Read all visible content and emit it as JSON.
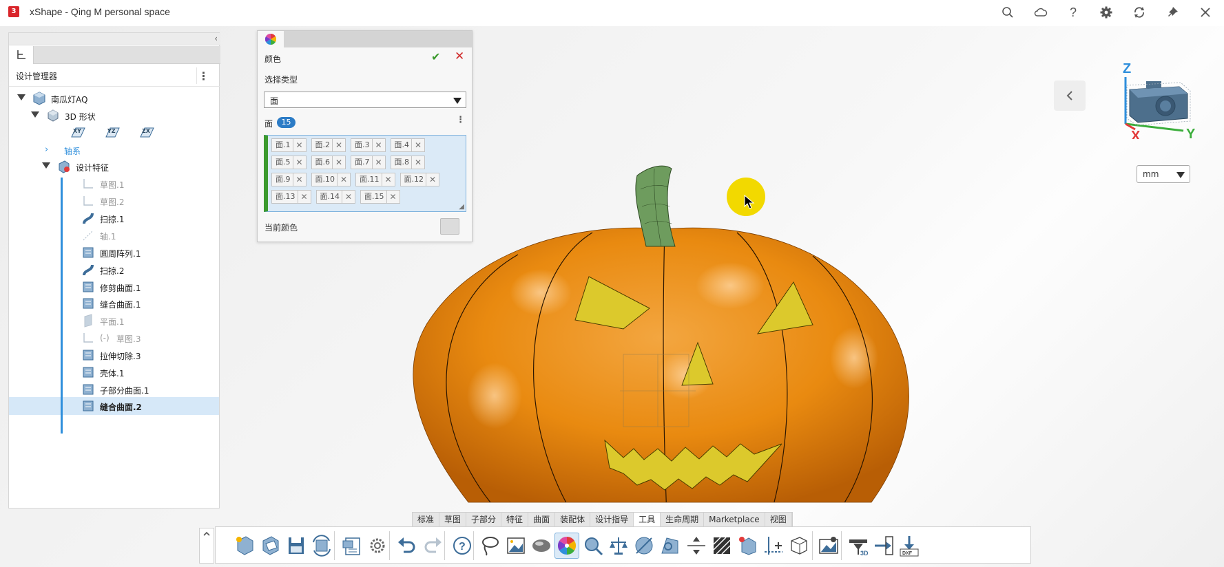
{
  "titlebar": {
    "title": "xShape - Qing M personal space",
    "icons": [
      "search-icon",
      "cloud-icon",
      "help-icon",
      "settings-gear-icon",
      "sync-icon",
      "pin-icon",
      "close-icon"
    ]
  },
  "design_manager": {
    "title": "设计管理器",
    "tree": [
      {
        "label": "南瓜灯AQ",
        "icon": "part-icon"
      },
      {
        "label": "3D 形状",
        "icon": "shape-icon"
      },
      {
        "label": "轴系",
        "icon": "chevron-right-icon"
      },
      {
        "label": "设计特征",
        "icon": "features-icon"
      },
      {
        "label": "草图.1",
        "icon": "sketch-icon"
      },
      {
        "label": "草图.2",
        "icon": "sketch-icon"
      },
      {
        "label": "扫掠.1",
        "icon": "sweep-icon"
      },
      {
        "label": "轴.1",
        "icon": "axis-icon"
      },
      {
        "label": "圆周阵列.1",
        "icon": "circular-pattern-icon"
      },
      {
        "label": "扫掠.2",
        "icon": "sweep-icon"
      },
      {
        "label": "修剪曲面.1",
        "icon": "trim-surface-icon"
      },
      {
        "label": "缝合曲面.1",
        "icon": "knit-surface-icon"
      },
      {
        "label": "平面.1",
        "icon": "plane-icon"
      },
      {
        "label": "(-)",
        "icon": "sketch-icon"
      },
      {
        "label": "草图.3",
        "icon": "sketch-icon"
      },
      {
        "label": "拉伸切除.3",
        "icon": "extrude-cut-icon"
      },
      {
        "label": "壳体.1",
        "icon": "shell-icon"
      },
      {
        "label": "子部分曲面.1",
        "icon": "subpart-surface-icon"
      },
      {
        "label": "缝合曲面.2",
        "icon": "knit-surface-icon"
      }
    ],
    "planes": [
      "XY",
      "YZ",
      "ZX"
    ]
  },
  "color_dialog": {
    "title": "颜色",
    "select_type_label": "选择类型",
    "select_type_value": "面",
    "face_label": "面",
    "face_count": "15",
    "faces": [
      "面.1",
      "面.2",
      "面.3",
      "面.4",
      "面.5",
      "面.6",
      "面.7",
      "面.8",
      "面.9",
      "面.10",
      "面.11",
      "面.12",
      "面.13",
      "面.14",
      "面.15"
    ],
    "current_color_label": "当前颜色",
    "current_color": "#dcdcdc"
  },
  "viewport": {
    "unit": "mm",
    "axes": {
      "z": "Z",
      "x": "X",
      "y": "Y"
    }
  },
  "bottom_tabs": [
    "标准",
    "草图",
    "子部分",
    "特征",
    "曲面",
    "装配体",
    "设计指导",
    "工具",
    "生命周期",
    "Marketplace",
    "视图"
  ],
  "active_tab": "工具",
  "toolbar_tools": [
    "new-part-icon",
    "open-icon",
    "save-icon",
    "regenerate-icon",
    "clipboard-icon",
    "options-gear-icon",
    "undo-icon",
    "redo-icon",
    "help-icon",
    "lasso-select-icon",
    "image-icon",
    "appearance-sphere-icon",
    "color-wheel-icon",
    "magnify-icon",
    "mass-properties-icon",
    "section-icon",
    "measure-icon",
    "distance-icon",
    "hatch-icon",
    "deviation-icon",
    "axis-add-icon",
    "boxes-icon",
    "screenshot-icon",
    "export-3d-icon",
    "export-icon",
    "export-dxf-icon"
  ],
  "colors": {
    "pumpkin": "#e98a10",
    "features": "#dcc92c",
    "stem": "#6e9c5e",
    "accent": "#2c7cc6",
    "cursor_highlight": "#f2d900"
  }
}
